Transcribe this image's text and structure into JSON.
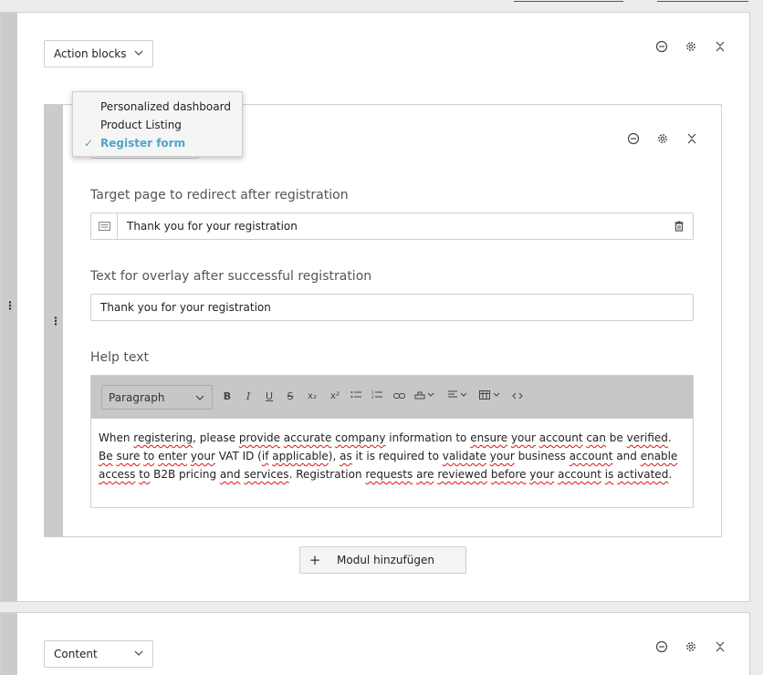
{
  "action_section": {
    "select_label": "Action blocks"
  },
  "module": {
    "dropdown_options": [
      {
        "label": "Personalized dashboard",
        "selected": false
      },
      {
        "label": "Product Listing",
        "selected": false
      },
      {
        "label": "Register form",
        "selected": true
      }
    ],
    "target_page_label": "Target page to redirect after registration",
    "target_page_value": "Thank you for your registration",
    "overlay_label": "Text for overlay after successful registration",
    "overlay_value": "Thank you for your registration",
    "help_label": "Help text",
    "editor": {
      "format_select": "Paragraph",
      "toolbar_items": [
        "B",
        "I",
        "U",
        "S",
        "x₂",
        "x²"
      ]
    }
  },
  "help_text_words": [
    "When ",
    "registering",
    ", please ",
    "provide",
    " ",
    "accurate",
    " ",
    "company",
    " information to ",
    "ensure",
    " ",
    "your",
    " ",
    "account",
    " ",
    "can",
    " be ",
    "verified",
    ". ",
    "Be",
    " ",
    "sure",
    " ",
    "to",
    " ",
    "enter",
    " ",
    "your",
    " VAT ID (",
    "if",
    " ",
    "applicable",
    "), ",
    "as",
    " it is required to ",
    "validate",
    " ",
    "your",
    " business ",
    "account",
    " and ",
    "enable",
    " ",
    "access",
    " ",
    "to",
    " B2B pricing ",
    "and",
    " ",
    "services",
    ". Registration ",
    "requests",
    " ",
    "are",
    " ",
    "reviewed",
    " ",
    "before",
    " ",
    "your",
    " ",
    "account",
    " ",
    "is",
    " ",
    "activated",
    "."
  ],
  "add_module_label": "Modul hinzufügen",
  "content_section": {
    "select_label": "Content"
  }
}
